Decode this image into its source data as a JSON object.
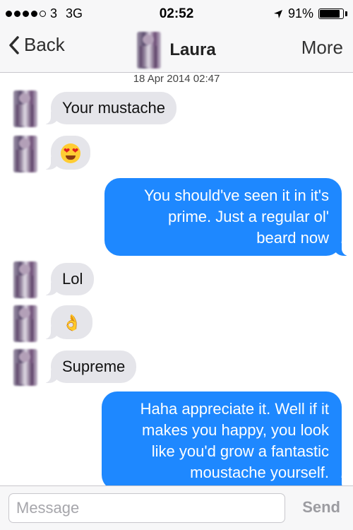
{
  "status_bar": {
    "carrier": "3",
    "network": "3G",
    "time": "02:52",
    "battery_percent_label": "91%",
    "battery_level": 0.91
  },
  "nav": {
    "back_label": "Back",
    "title": "Laura",
    "more_label": "More"
  },
  "conversation": {
    "timestamp": "18 Apr 2014 02:47",
    "messages": [
      {
        "direction": "in",
        "text": "Your mustache"
      },
      {
        "direction": "in",
        "emoji": "smiling-face-heart-eyes"
      },
      {
        "direction": "out",
        "lines": [
          "You should've seen it in it's",
          "prime. Just a regular ol'",
          "beard now"
        ]
      },
      {
        "direction": "in",
        "text": "Lol"
      },
      {
        "direction": "in",
        "emoji": "ok-hand"
      },
      {
        "direction": "in",
        "text": "Supreme"
      },
      {
        "direction": "out",
        "lines": [
          "Haha appreciate it. Well if it",
          "makes you happy, you look",
          "like you'd grow a fantastic",
          "moustache yourself."
        ]
      }
    ]
  },
  "composer": {
    "placeholder": "Message",
    "send_label": "Send"
  },
  "colors": {
    "outgoing_bubble": "#1e88ff",
    "incoming_bubble": "#e5e5ea",
    "bar_background": "#f7f7f8"
  }
}
